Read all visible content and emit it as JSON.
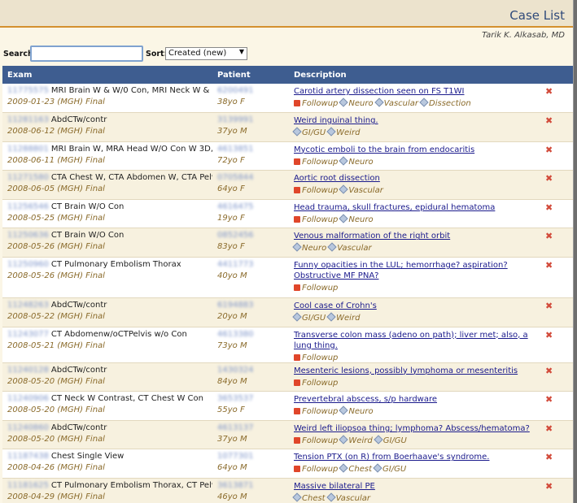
{
  "header": {
    "title": "Case List",
    "user": "Tarik K. Alkasab, MD"
  },
  "controls": {
    "search_label": "Search:",
    "search_value": "",
    "sort_label": "Sort:",
    "sort_value": "Created (new)"
  },
  "columns": {
    "exam": "Exam",
    "patient": "Patient",
    "description": "Description"
  },
  "rows": [
    {
      "mrn": "11775575",
      "exam": "MRI Brain W & W/0 Con, MRI Neck W & ...",
      "meta": "2009-01-23 (MGH) Final",
      "patient_id": "6200491",
      "age_sex": "38yo F",
      "description": "Carotid artery dissection seen on FS T1WI",
      "followup": "Followup",
      "tags": [
        "Neuro",
        "Vascular",
        "Dissection"
      ]
    },
    {
      "mrn": "11281163",
      "exam": "AbdCTw/contr",
      "meta": "2008-06-12 (MGH) Final",
      "patient_id": "3139991",
      "age_sex": "37yo M",
      "description": "Weird inguinal thing.",
      "followup": "",
      "tags": [
        "GI/GU",
        "Weird"
      ]
    },
    {
      "mrn": "11288801",
      "exam": "MRI Brain W, MRA Head W/O Con W 3D, M...",
      "meta": "2008-06-11 (MGH) Final",
      "patient_id": "4613851",
      "age_sex": "72yo F",
      "description": "Mycotic emboli to the brain from endocaritis",
      "followup": "Followup",
      "tags": [
        "Neuro"
      ]
    },
    {
      "mrn": "11271580",
      "exam": "CTA Chest W, CTA Abdomen W, CTA Pelvis W",
      "meta": "2008-06-05 (MGH) Final",
      "patient_id": "0705844",
      "age_sex": "64yo F",
      "description": "Aortic root dissection",
      "followup": "Followup",
      "tags": [
        "Vascular"
      ]
    },
    {
      "mrn": "11256546",
      "exam": "CT Brain W/O Con",
      "meta": "2008-05-25 (MGH) Final",
      "patient_id": "4616475",
      "age_sex": "19yo F",
      "description": "Head trauma, skull fractures, epidural hematoma",
      "followup": "Followup",
      "tags": [
        "Neuro"
      ]
    },
    {
      "mrn": "11250636",
      "exam": "CT Brain W/O Con",
      "meta": "2008-05-26 (MGH) Final",
      "patient_id": "0852456",
      "age_sex": "83yo F",
      "description": "Venous malformation of the right orbit",
      "followup": "",
      "tags": [
        "Neuro",
        "Vascular"
      ]
    },
    {
      "mrn": "11250960",
      "exam": "CT Pulmonary Embolism Thorax",
      "meta": "2008-05-26 (MGH) Final",
      "patient_id": "4411773",
      "age_sex": "40yo M",
      "description": "Funny opacities in the LUL; hemorrhage? aspiration? Obstructive MF PNA?",
      "followup": "Followup",
      "tags": []
    },
    {
      "mrn": "11248263",
      "exam": "AbdCTw/contr",
      "meta": "2008-05-22 (MGH) Final",
      "patient_id": "6194883",
      "age_sex": "20yo M",
      "description": "Cool case of Crohn's",
      "followup": "",
      "tags": [
        "GI/GU",
        "Weird"
      ]
    },
    {
      "mrn": "11243077",
      "exam": "CT Abdomenw/oCTPelvis w/o Con",
      "meta": "2008-05-21 (MGH) Final",
      "patient_id": "4613380",
      "age_sex": "73yo M",
      "description": "Transverse colon mass (adeno on path); liver met; also, a lung thing.",
      "followup": "Followup",
      "tags": []
    },
    {
      "mrn": "11240128",
      "exam": "AbdCTw/contr",
      "meta": "2008-05-20 (MGH) Final",
      "patient_id": "1430324",
      "age_sex": "84yo M",
      "description": "Mesenteric lesions, possibly lymphoma or mesenteritis",
      "followup": "Followup",
      "tags": []
    },
    {
      "mrn": "11240906",
      "exam": "CT Neck W Contrast, CT Chest W Con",
      "meta": "2008-05-20 (MGH) Final",
      "patient_id": "3653537",
      "age_sex": "55yo F",
      "description": "Prevertebral abscess, s/p hardware",
      "followup": "Followup",
      "tags": [
        "Neuro"
      ]
    },
    {
      "mrn": "11240860",
      "exam": "AbdCTw/contr",
      "meta": "2008-05-20 (MGH) Final",
      "patient_id": "4613137",
      "age_sex": "37yo M",
      "description": "Weird left iliopsoa thing; lymphoma? Abscess/hematoma?",
      "followup": "Followup",
      "tags": [
        "Weird",
        "GI/GU"
      ]
    },
    {
      "mrn": "11187438",
      "exam": "Chest Single View",
      "meta": "2008-04-26 (MGH) Final",
      "patient_id": "1077301",
      "age_sex": "64yo M",
      "description": "Tension PTX (on R) from Boerhaave's syndrome.",
      "followup": "Followup",
      "tags": [
        "Chest",
        "GI/GU"
      ]
    },
    {
      "mrn": "11181625",
      "exam": "CT Pulmonary Embolism Thorax, CT Pelvis",
      "meta": "2008-04-29 (MGH) Final",
      "patient_id": "3613871",
      "age_sex": "46yo M",
      "description": "Massive bilateral PE",
      "followup": "",
      "tags": [
        "Chest",
        "Vascular"
      ]
    }
  ],
  "colors": {
    "header_band": "#ece3cd",
    "accent_rule": "#d4902e",
    "table_header": "#3e5d90",
    "link": "#1a1a8c",
    "meta_text": "#8a6a2a",
    "delete": "#d24a3a"
  },
  "icons": {
    "followup": "flag-icon",
    "tag": "tag-icon",
    "delete": "close-icon"
  }
}
